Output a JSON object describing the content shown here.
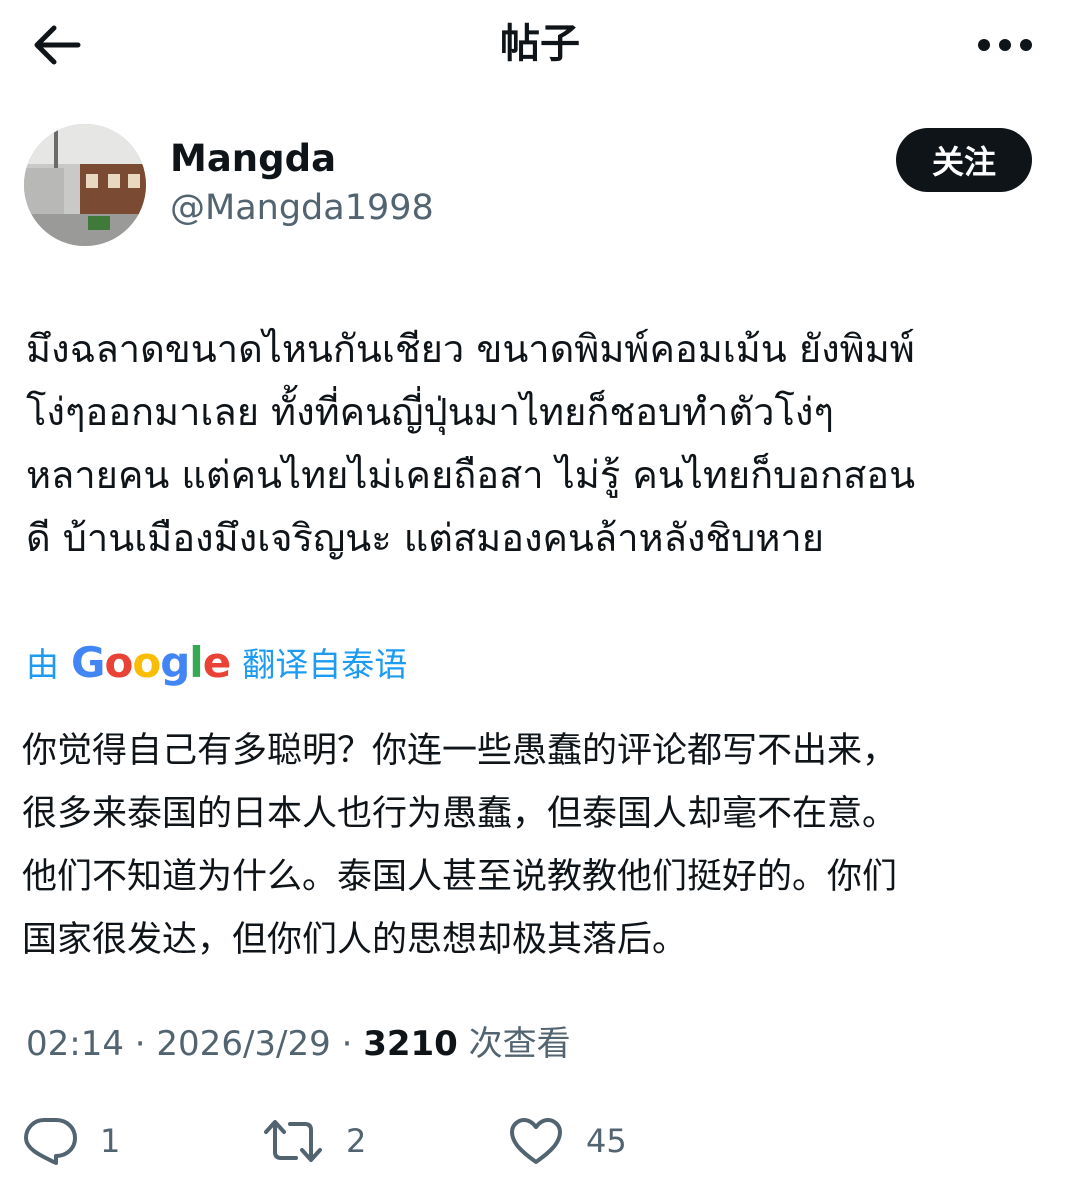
{
  "header": {
    "title": "帖子",
    "back_icon": "back-arrow-icon",
    "more_icon": "more-horizontal-icon"
  },
  "author": {
    "name": "Mangda",
    "handle": "@Mangda1998",
    "follow_label": "关注"
  },
  "post": {
    "original_lines": [
      "มึงฉลาดขนาดไหนกันเชียว ขนาดพิมพ์คอมเม้น ยังพิมพ์",
      "โง่ๆออกมาเลย ทั้งที่คนญี่ปุ่นมาไทยก็ชอบทำตัวโง่ๆ",
      "หลายคน แต่คนไทยไม่เคยถือสา ไม่รู้ คนไทยก็บอกสอน",
      "ดี บ้านเมืองมึงเจริญนะ แต่สมองคนล้าหลังชิบหาย"
    ],
    "translation_prefix": "由",
    "translation_provider": "Google",
    "translation_suffix": "翻译自泰语",
    "translated_lines": [
      "你觉得自己有多聪明？你连一些愚蠢的评论都写不出来，",
      "很多来泰国的日本人也行为愚蠢，但泰国人却毫不在意。",
      "他们不知道为什么。泰国人甚至说教教他们挺好的。你们",
      "国家很发达，但你们人的思想却极其落后。"
    ]
  },
  "meta": {
    "time": "02:14",
    "date": "2026/3/29",
    "separator": " · ",
    "views_count": "3210",
    "views_label": " 次查看"
  },
  "actions": {
    "replies": "1",
    "retweets": "2",
    "likes": "45"
  },
  "colors": {
    "text": "#0f1419",
    "secondary": "#536471",
    "link": "#1d9bf0",
    "google_blue": "#4285f4",
    "google_red": "#ea4335",
    "google_yellow": "#fbbc05",
    "google_green": "#34a853"
  }
}
